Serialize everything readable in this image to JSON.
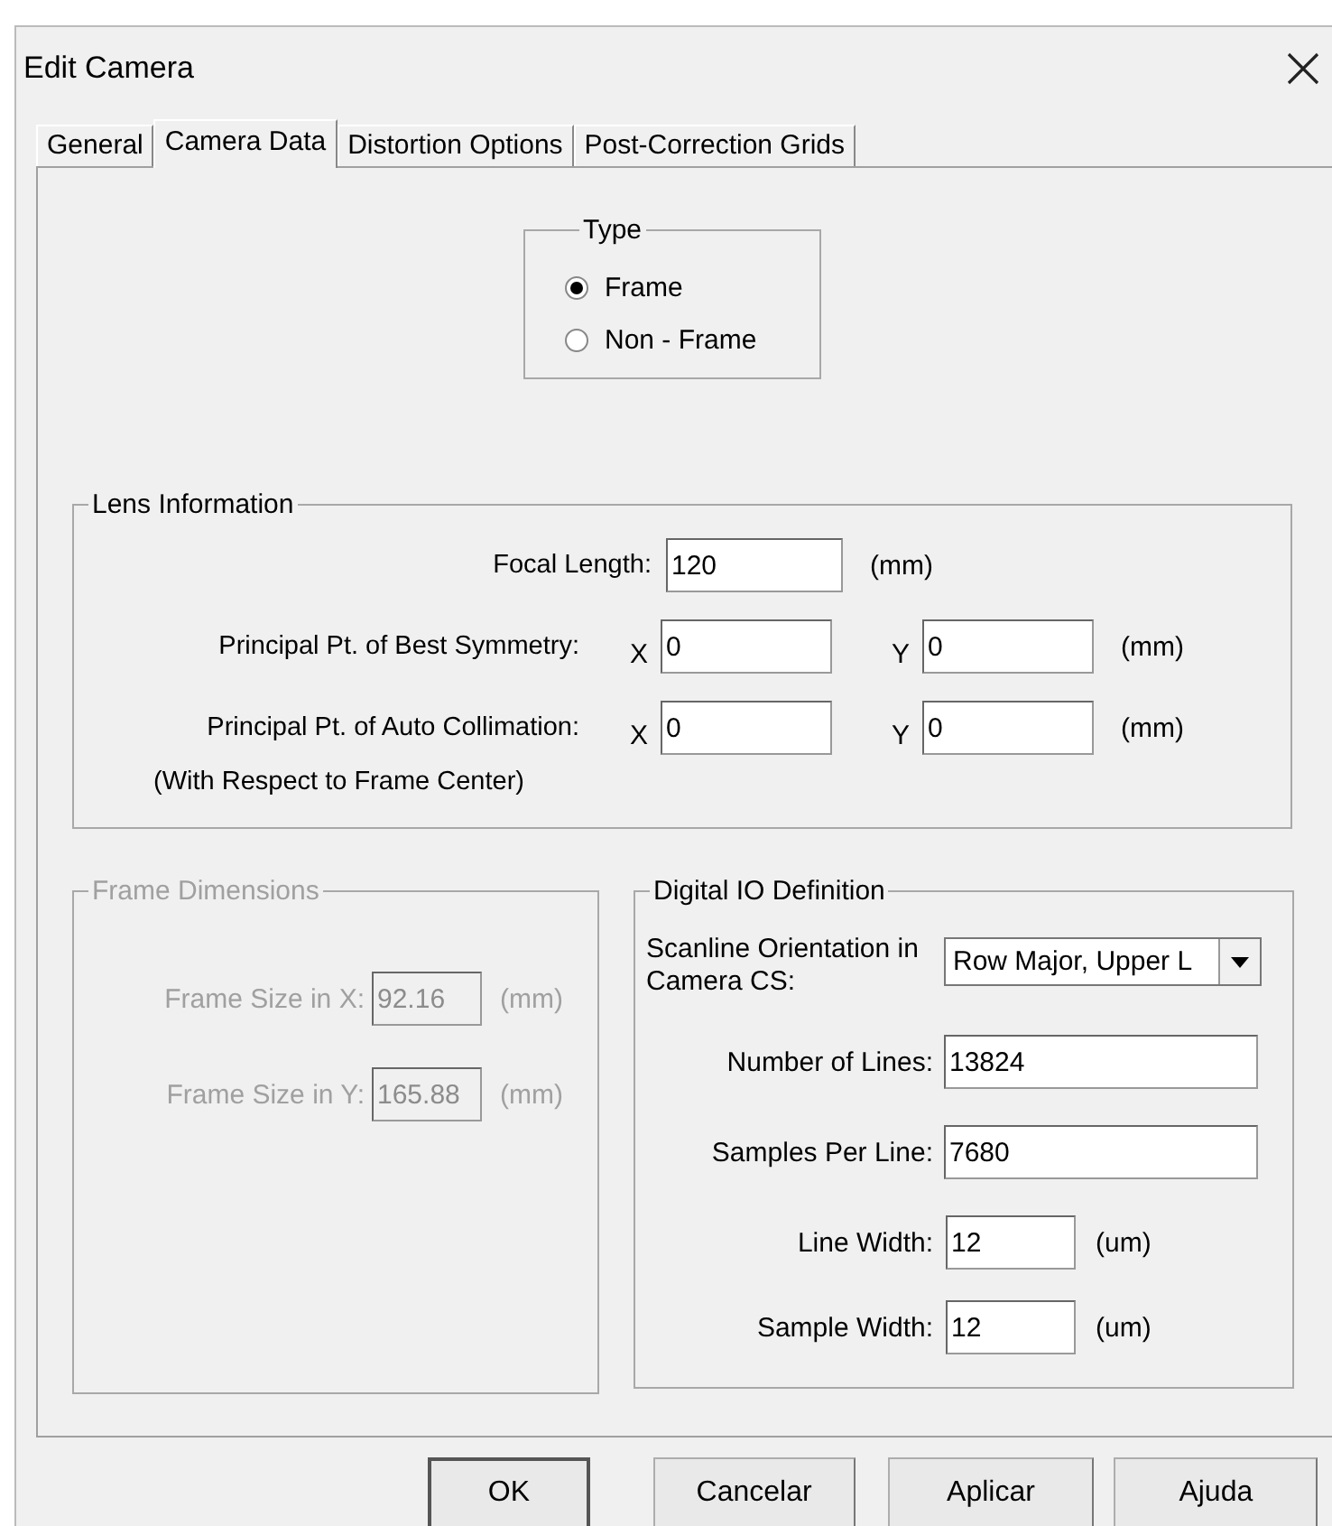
{
  "window": {
    "title": "Edit Camera"
  },
  "tabs": [
    {
      "label": "General",
      "selected": false
    },
    {
      "label": "Camera Data",
      "selected": true
    },
    {
      "label": "Distortion Options",
      "selected": false
    },
    {
      "label": "Post-Correction Grids",
      "selected": false
    }
  ],
  "type_group": {
    "title": "Type",
    "options": [
      {
        "label": "Frame",
        "selected": true
      },
      {
        "label": "Non - Frame",
        "selected": false
      }
    ]
  },
  "lens_information": {
    "title": "Lens Information",
    "rows": [
      {
        "kind": "single",
        "label": "Focal Length:",
        "value": "120",
        "unit": "(mm)"
      },
      {
        "kind": "xy",
        "label": "Principal Pt. of Best Symmetry:",
        "x_label": "X",
        "x_value": "0",
        "y_label": "Y",
        "y_value": "0",
        "unit": "(mm)"
      },
      {
        "kind": "xy",
        "label": "Principal Pt. of Auto Collimation:",
        "x_label": "X",
        "x_value": "0",
        "y_label": "Y",
        "y_value": "0",
        "unit": "(mm)",
        "note": "(With Respect to Frame Center)"
      }
    ]
  },
  "frame_dimensions": {
    "title": "Frame Dimensions",
    "disabled": true,
    "rows": [
      {
        "label": "Frame Size in X:",
        "value": "92.16",
        "unit": "(mm)"
      },
      {
        "label": "Frame Size in Y:",
        "value": "165.88",
        "unit": "(mm)"
      }
    ]
  },
  "digital_io": {
    "title": "Digital IO Definition",
    "rows": [
      {
        "kind": "select",
        "label": "Scanline Orientation in Camera CS:",
        "value": "Row Major, Upper L"
      },
      {
        "kind": "wide",
        "label": "Number of Lines:",
        "value": "13824"
      },
      {
        "kind": "wide",
        "label": "Samples Per Line:",
        "value": "7680"
      },
      {
        "kind": "narrow",
        "label": "Line Width:",
        "value": "12",
        "unit": "(um)"
      },
      {
        "kind": "narrow",
        "label": "Sample Width:",
        "value": "12",
        "unit": "(um)"
      }
    ]
  },
  "buttons": [
    {
      "label": "OK",
      "default": true
    },
    {
      "label": "Cancelar",
      "default": false
    },
    {
      "label": "Aplicar",
      "default": false
    },
    {
      "label": "Ajuda",
      "default": false
    }
  ]
}
